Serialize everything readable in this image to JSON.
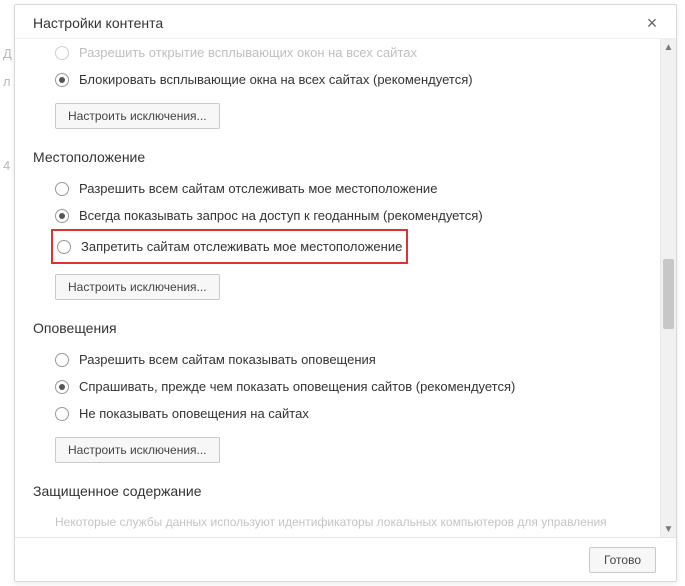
{
  "dialog": {
    "title": "Настройки контента",
    "close_label": "×"
  },
  "sections": {
    "popups": {
      "opt_allow": "Разрешить открытие всплывающих окон на всех сайтах",
      "opt_block": "Блокировать всплывающие окна на всех сайтах (рекомендуется)",
      "manage": "Настроить исключения..."
    },
    "location": {
      "heading": "Местоположение",
      "opt_allow": "Разрешить всем сайтам отслеживать мое местоположение",
      "opt_ask": "Всегда показывать запрос на доступ к геоданным (рекомендуется)",
      "opt_block": "Запретить сайтам отслеживать мое местоположение",
      "manage": "Настроить исключения..."
    },
    "notifications": {
      "heading": "Оповещения",
      "opt_allow": "Разрешить всем сайтам показывать оповещения",
      "opt_ask": "Спрашивать, прежде чем показать оповещения сайтов (рекомендуется)",
      "opt_block": "Не показывать оповещения на сайтах",
      "manage": "Настроить исключения..."
    },
    "protected": {
      "heading": "Защищенное содержание",
      "desc": "Некоторые службы данных используют идентификаторы локальных компьютеров для управления"
    }
  },
  "footer": {
    "done": "Готово"
  }
}
